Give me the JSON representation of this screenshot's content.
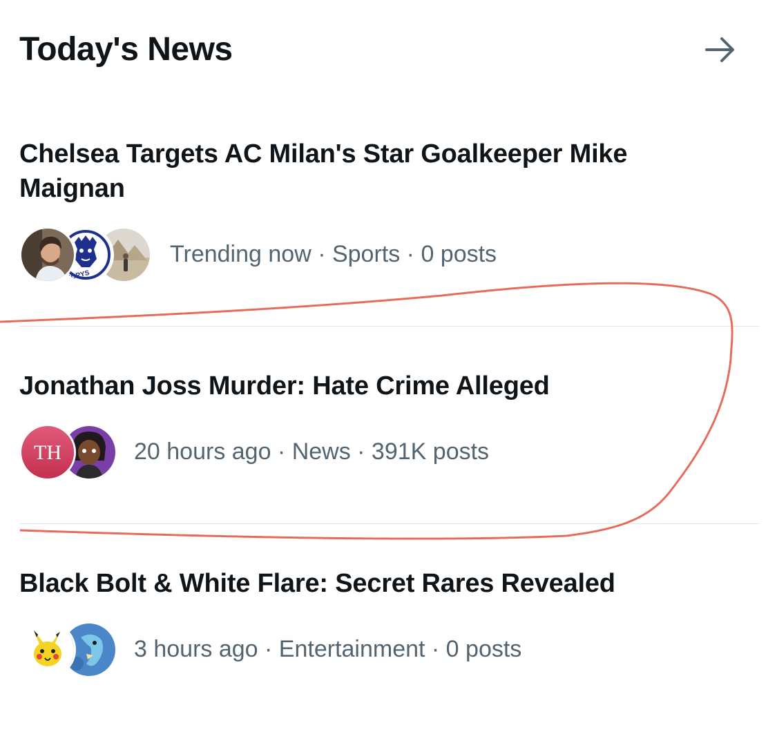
{
  "header": {
    "title": "Today's News",
    "arrow_icon": "arrow-right-icon"
  },
  "items": [
    {
      "title": "Chelsea Targets AC Milan's Star Goalkeeper Mike Maignan",
      "meta": "Trending now · Sports · 0 posts",
      "avatars": [
        "man-portrait-avatar",
        "fcpys-lion-logo-avatar",
        "pyramids-avatar"
      ],
      "avatar_text": "FCPYS"
    },
    {
      "title": "Jonathan Joss Murder: Hate Crime Alleged",
      "meta": "20 hours ago · News · 391K posts",
      "avatars": [
        "th-logo-avatar",
        "cartoon-character-avatar"
      ],
      "avatar_text": "TH"
    },
    {
      "title": "Black Bolt & White Flare: Secret Rares Revealed",
      "meta": "3 hours ago · Entertainment · 0 posts",
      "avatars": [
        "pikachu-avatar",
        "horsea-avatar"
      ]
    }
  ],
  "colors": {
    "text": "#0f1419",
    "meta": "#536471",
    "divider": "#e2e6ea",
    "annotation": "#e0523f"
  }
}
